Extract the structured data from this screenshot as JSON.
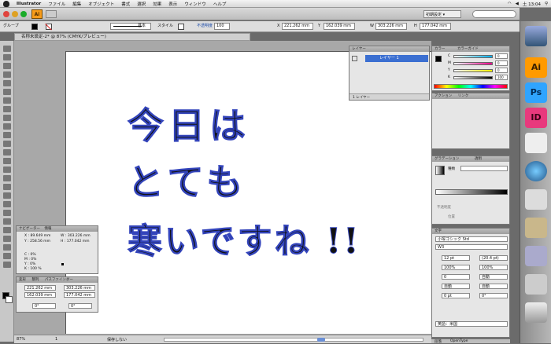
{
  "menubar": {
    "app": "Illustrator",
    "items": [
      "ファイル",
      "編集",
      "オブジェクト",
      "書式",
      "選択",
      "効果",
      "表示",
      "ウィンドウ",
      "ヘルプ"
    ],
    "clock": "土 13:04"
  },
  "appbar": {
    "badge": "Ai",
    "workspace": "初期設定 ▾"
  },
  "control": {
    "selection_label": "グループ",
    "style_label": "スタイル",
    "opacity_label": "不透明度",
    "opacity_value": "100",
    "x_label": "X",
    "x_value": "221.262 mm",
    "y_label": "Y",
    "y_value": "162.039 mm",
    "w_label": "W",
    "w_value": "303.226 mm",
    "h_label": "H",
    "h_value": "177.042 mm",
    "stroke_label": "基本"
  },
  "document": {
    "tab_title": "名称未設定-2* @ 87% (CMYK/プレビュー)",
    "lines": [
      "今日は",
      "とても",
      "寒いですね !!"
    ],
    "zoom": "87%",
    "status": "保存しない",
    "page": "1"
  },
  "layers_panel": {
    "tab": "レイヤー",
    "layer_name": "レイヤー 1",
    "footer": "1 レイヤー"
  },
  "color_panel": {
    "tab1": "カラー",
    "tab2": "カラーガイド",
    "channels": [
      "C",
      "M",
      "Y",
      "K"
    ],
    "values": [
      "0",
      "0",
      "0",
      "100"
    ],
    "unit": "%"
  },
  "actions_panel": {
    "tab1": "アクション",
    "tab2": "リンク"
  },
  "gradient_panel": {
    "tab1": "グラデーション",
    "tab2": "透明",
    "type_label": "種類",
    "opacity_label": "不透明度",
    "position_label": "位置"
  },
  "char_panel": {
    "tab": "文字",
    "font": "小塚ゴシック Std",
    "weight": "W3",
    "size": "12 pt",
    "leading": "(20.4 pt)",
    "hscale": "100%",
    "vscale": "100%",
    "tracking": "0",
    "kerning": "自動",
    "baseline": "0 pt",
    "rotate": "0°",
    "lang": "英語：米国"
  },
  "info_panel": {
    "tab1": "ナビゲーター",
    "tab2": "情報",
    "x": "X : 89.649 mm",
    "y": "Y : 258.56 mm",
    "w": "W : 303.226 mm",
    "h": "H : 177.042 mm",
    "cmyk": [
      "C : 0%",
      "M : 0%",
      "Y : 0%",
      "K : 100 %"
    ]
  },
  "transform_panel": {
    "tab1": "変形",
    "tab2": "整列",
    "tab3": "パスファインダー",
    "x": "221.262 mm",
    "y": "162.039 mm",
    "w": "303.226 mm",
    "h": "177.042 mm",
    "rot": "0°",
    "shear": "0°"
  },
  "bottom_tabs": {
    "tab1": "段落",
    "tab2": "OpenType"
  },
  "dock": {
    "apps": [
      "",
      "Ai",
      "Ps",
      "ID",
      "",
      "",
      "",
      "",
      "",
      ""
    ],
    "colors": {
      "ai": "#ff9a00",
      "ps": "#2fa4ff",
      "id": "#e8397d"
    }
  }
}
